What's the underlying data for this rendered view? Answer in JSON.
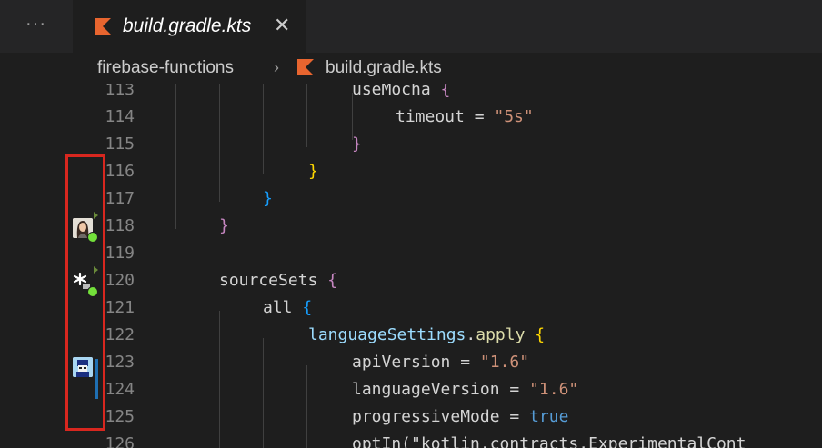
{
  "tabbar": {
    "more_label": "···",
    "active_tab": {
      "label": "build.gradle.kts",
      "icon": "kotlin-icon",
      "close_glyph": "✕"
    }
  },
  "breadcrumb": {
    "folder": "firebase-functions",
    "separator": "›",
    "file": "build.gradle.kts",
    "file_icon": "kotlin-icon"
  },
  "editor": {
    "lines": [
      {
        "number": "113",
        "tokens": [
          {
            "t": "useMocha",
            "c": "c-ident"
          },
          {
            "t": " "
          },
          {
            "t": "{",
            "c": "k-magenta"
          }
        ]
      },
      {
        "number": "114",
        "tokens": [
          {
            "t": "timeout",
            "c": "c-ident"
          },
          {
            "t": " = ",
            "c": "c-ident"
          },
          {
            "t": "\"5s\"",
            "c": "c-str"
          }
        ]
      },
      {
        "number": "115",
        "tokens": [
          {
            "t": "}",
            "c": "k-magenta"
          }
        ]
      },
      {
        "number": "116",
        "tokens": [
          {
            "t": "}",
            "c": "k-gold"
          }
        ]
      },
      {
        "number": "117",
        "tokens": [
          {
            "t": "}",
            "c": "k-blue"
          }
        ]
      },
      {
        "number": "118",
        "tokens": [
          {
            "t": "}",
            "c": "k-magenta"
          }
        ]
      },
      {
        "number": "119",
        "tokens": []
      },
      {
        "number": "120",
        "tokens": [
          {
            "t": "sourceSets",
            "c": "c-ident"
          },
          {
            "t": " "
          },
          {
            "t": "{",
            "c": "k-magenta"
          }
        ]
      },
      {
        "number": "121",
        "tokens": [
          {
            "t": "all",
            "c": "c-ident"
          },
          {
            "t": " "
          },
          {
            "t": "{",
            "c": "k-blue"
          }
        ]
      },
      {
        "number": "122",
        "tokens": [
          {
            "t": "languageSettings",
            "c": "c-var"
          },
          {
            "t": ".",
            "c": "c-ident"
          },
          {
            "t": "apply",
            "c": "c-fn"
          },
          {
            "t": " "
          },
          {
            "t": "{",
            "c": "k-gold"
          }
        ]
      },
      {
        "number": "123",
        "tokens": [
          {
            "t": "apiVersion",
            "c": "c-ident"
          },
          {
            "t": " = ",
            "c": "c-ident"
          },
          {
            "t": "\"1.6\"",
            "c": "c-str"
          }
        ]
      },
      {
        "number": "124",
        "tokens": [
          {
            "t": "languageVersion",
            "c": "c-ident"
          },
          {
            "t": " = ",
            "c": "c-ident"
          },
          {
            "t": "\"1.6\"",
            "c": "c-str"
          }
        ]
      },
      {
        "number": "125",
        "tokens": [
          {
            "t": "progressiveMode",
            "c": "c-ident"
          },
          {
            "t": " = ",
            "c": "c-ident"
          },
          {
            "t": "true",
            "c": "c-keyword"
          }
        ]
      },
      {
        "number": "126",
        "tokens": [
          {
            "t": "optIn(\"kotlin.contracts.ExperimentalCont",
            "c": "c-ident"
          }
        ]
      }
    ]
  },
  "gutter_decorations": [
    {
      "line": "118",
      "icon": "user-avatar-woman-icon",
      "status": "online"
    },
    {
      "line": "120",
      "icon": "user-avatar-asterisk-icon",
      "status": "online"
    },
    {
      "line": "123",
      "icon": "user-avatar-pixel-icon",
      "status": "none"
    }
  ],
  "colors": {
    "highlight_box": "#d8271f",
    "online_dot": "#73e03a",
    "bracket_magenta": "#c586c0",
    "bracket_gold": "#ffd700",
    "bracket_blue": "#179fff",
    "string": "#ce9178",
    "keyword": "#569cd6",
    "kotlin_logo": "#e8652f"
  }
}
